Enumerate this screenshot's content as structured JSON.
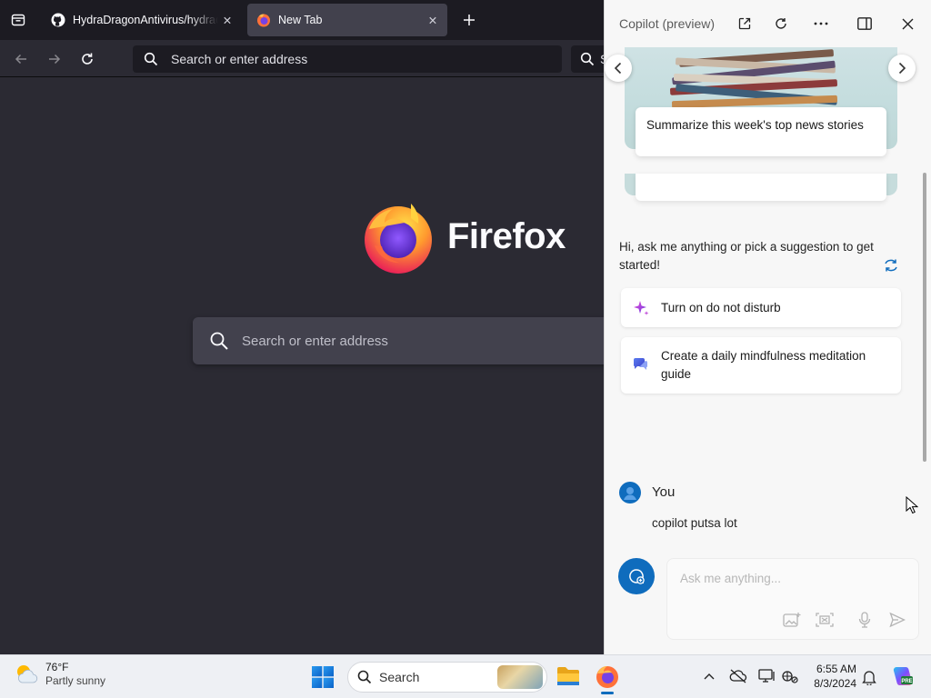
{
  "browser": {
    "tabs": [
      {
        "title": "HydraDragonAntivirus/hydrad"
      },
      {
        "title": "New Tab"
      }
    ],
    "address_placeholder": "Search or enter address",
    "search_partial": "S",
    "wordmark": "Firefox",
    "page_search_placeholder": "Search or enter address"
  },
  "copilot": {
    "title": "Copilot (preview)",
    "carousel_caption": "Summarize this week's top news stories",
    "greeting": "Hi, ask me anything or pick a suggestion to get started!",
    "suggestions": [
      {
        "label": "Turn on do not disturb"
      },
      {
        "label": "Create a daily mindfulness meditation guide"
      }
    ],
    "conversation": {
      "author": "You",
      "message": "copilot putsa lot"
    },
    "input_placeholder": "Ask me anything..."
  },
  "taskbar": {
    "weather_temp": "76°F",
    "weather_condition": "Partly sunny",
    "search_label": "Search",
    "time": "6:55 AM",
    "date": "8/3/2024"
  },
  "colors": {
    "firefox_bg": "#2b2a33",
    "firefox_tabbar": "#1c1b22",
    "accent_blue": "#0f6cbd",
    "copilot_bg": "#f7f7f7"
  }
}
